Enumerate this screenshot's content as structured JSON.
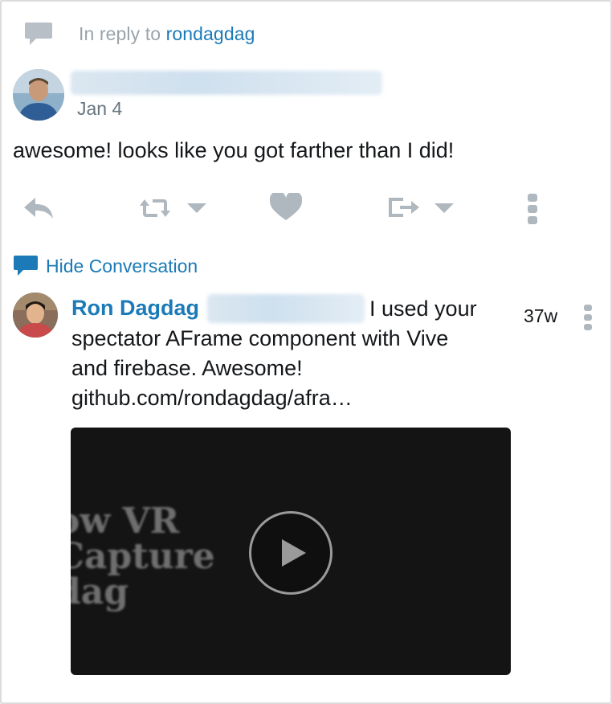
{
  "reply": {
    "prefix": "In reply to",
    "username": "rondagdag"
  },
  "tweet": {
    "date": "Jan 4",
    "text": "awesome! looks like you got farther than I did!"
  },
  "actions": {
    "icons": [
      "reply-icon",
      "retweet-icon",
      "like-icon",
      "share-icon",
      "more-icon"
    ]
  },
  "conversation": {
    "toggle_label": "Hide Conversation"
  },
  "reply_tweet": {
    "author": "Ron Dagdag",
    "text_line1": "I used your",
    "text_line2": "spectator AFrame component with Vive",
    "text_line3": "and firebase. Awesome!",
    "link": "github.com/rondagdag/afra…",
    "age": "37w",
    "video_text": [
      "ow VR",
      "Capture",
      "dag"
    ]
  },
  "colors": {
    "link": "#1b7ab7",
    "muted": "#9aa3ab",
    "icon": "#b0b8bf"
  }
}
